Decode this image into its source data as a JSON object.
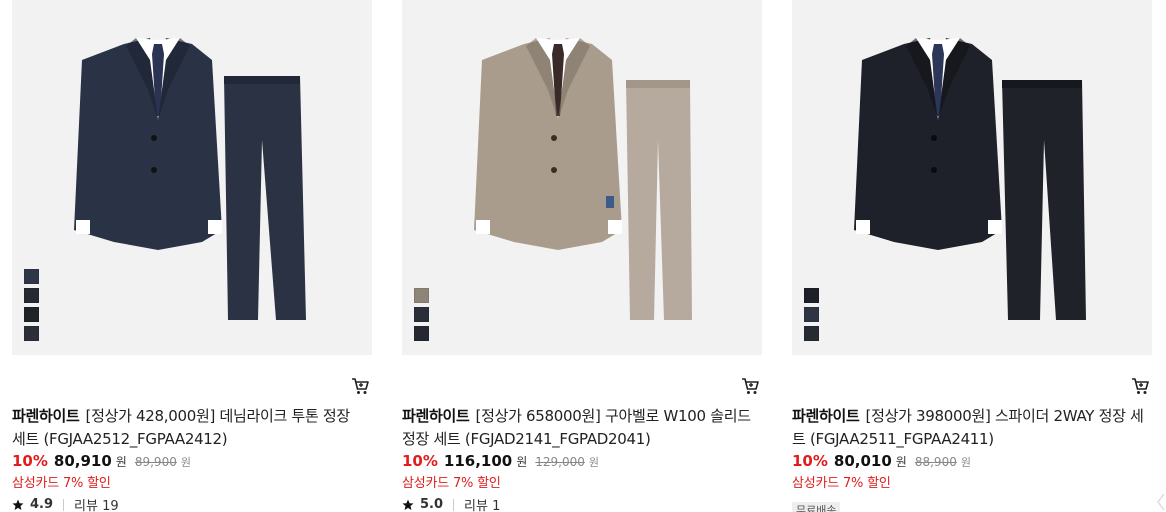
{
  "products": [
    {
      "brand": "파렌하이트",
      "name": "[정상가 428,000원] 데님라이크 투톤 정장 세트 (FGJAA2512_FGPAA2412)",
      "discount": "10%",
      "price": "80,910",
      "currency": "원",
      "original_price": "89,900",
      "original_currency": "원",
      "card_promo": "삼성카드 7% 할인",
      "rating": "4.9",
      "reviews": "리뷰 19",
      "jacket_color": "#2a3346",
      "pants_color": "#2b3244",
      "swatches": [
        "#2e3648",
        "#262a33",
        "#1f2229",
        "#2b2f38"
      ]
    },
    {
      "brand": "파렌하이트",
      "name": "[정상가 658000원] 구아벨로 W100 솔리드 정장 세트 (FGJAD2141_FGPAD2041)",
      "discount": "10%",
      "price": "116,100",
      "currency": "원",
      "original_price": "129,000",
      "original_currency": "원",
      "card_promo": "삼성카드 7% 할인",
      "rating": "5.0",
      "reviews": "리뷰 1",
      "jacket_color": "#a99c8c",
      "pants_color": "#b5aa9d",
      "swatches": [
        "#8e8478",
        "#2a2e38",
        "#252832"
      ]
    },
    {
      "brand": "파렌하이트",
      "name": "[정상가 398000원] 스파이더 2WAY 정장 세트 (FGJAA2511_FGPAA2411)",
      "discount": "10%",
      "price": "80,010",
      "currency": "원",
      "original_price": "88,900",
      "original_currency": "원",
      "card_promo": "삼성카드 7% 할인",
      "badge": "무료배송",
      "jacket_color": "#1e2129",
      "pants_color": "#1f2229",
      "swatches": [
        "#1e2027",
        "#2f3444",
        "#262a33"
      ]
    }
  ]
}
